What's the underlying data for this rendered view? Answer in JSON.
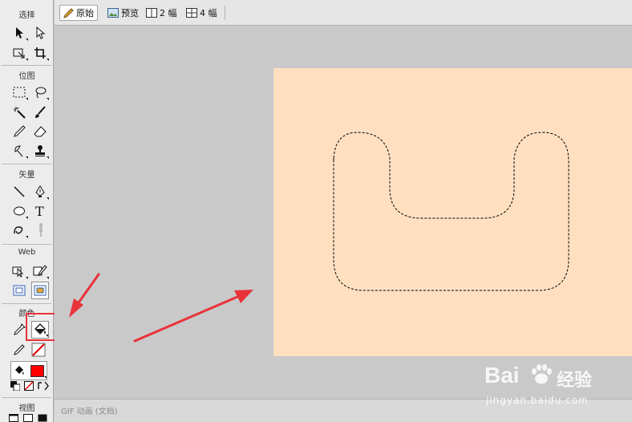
{
  "toolbar": {
    "sections": {
      "select": "选择",
      "bitmap": "位图",
      "vector": "矢量",
      "web": "Web",
      "colors": "颜色",
      "view": "视图"
    }
  },
  "tabs": [
    {
      "label": "原始",
      "icon": "pencil-icon",
      "active": true
    },
    {
      "label": "预览",
      "icon": "image-preview-icon",
      "active": false
    },
    {
      "label": "2 幅",
      "icon": "two-up-icon",
      "active": false
    },
    {
      "label": "4 幅",
      "icon": "four-up-icon",
      "active": false
    }
  ],
  "status": {
    "text": "GIF 动画 (文档)"
  },
  "colors": {
    "document_bg": "#ffdfc0",
    "workspace_bg": "#c9c9c9",
    "annotation": "#e8333a",
    "fill_swatch": "#ff0000"
  },
  "watermark": {
    "logo": "Bai",
    "cn": "经验",
    "url": "jingyan.baidu.com"
  }
}
